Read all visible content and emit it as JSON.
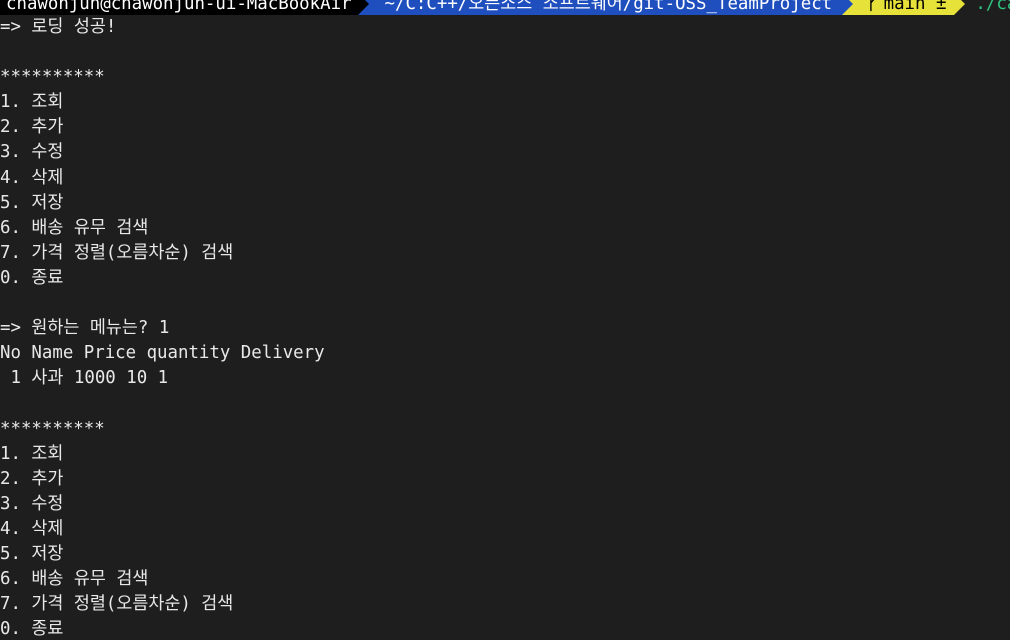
{
  "prompt": {
    "user_host": "chawonjun@chawonjun-ui-MacBookAir",
    "path": "~/C:C++/오픈소스 소프트웨어/git-OSS_TeamProject",
    "git_icon": "git-branch-icon",
    "git_symbol": "ᚠ",
    "branch": "main ±",
    "command": "./calculator"
  },
  "output_lines": [
    "=> 로딩 성공!",
    "",
    "**********",
    "1. 조회",
    "2. 추가",
    "3. 수정",
    "4. 삭제",
    "5. 저장",
    "6. 배송 유무 검색",
    "7. 가격 정렬(오름차순) 검색",
    "0. 종료",
    "",
    "=> 원하는 메뉴는? 1",
    "No Name Price quantity Delivery",
    " 1 사과 1000 10 1",
    "",
    "**********",
    "1. 조회",
    "2. 추가",
    "3. 수정",
    "4. 삭제",
    "5. 저장",
    "6. 배송 유무 검색",
    "7. 가격 정렬(오름차순) 검색",
    "0. 종료"
  ],
  "colors": {
    "background": "#1e1e1e",
    "user_segment": "#000000",
    "path_segment": "#1f4fbf",
    "git_segment": "#e7e23a",
    "command_text": "#2ec27e",
    "text": "#e8e8e8"
  }
}
